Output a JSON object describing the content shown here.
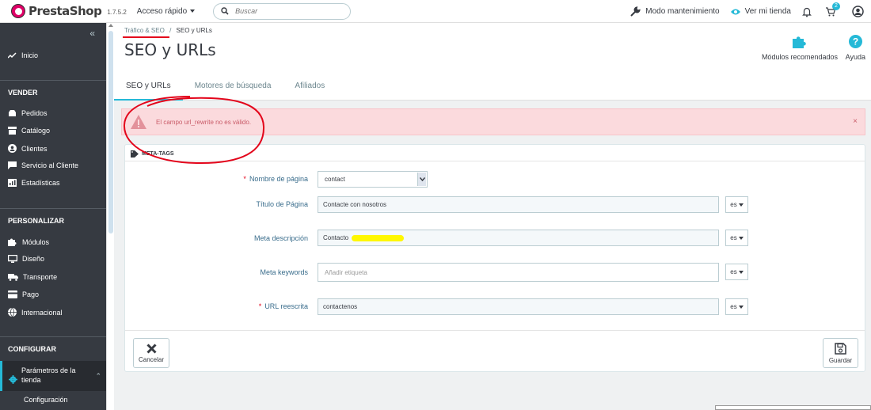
{
  "topbar": {
    "logo_text": "PrestaShop",
    "version": "1.7.5.2",
    "quick_access": "Acceso rápido",
    "search_placeholder": "Buscar",
    "maintenance": "Modo mantenimiento",
    "view_store": "Ver mi tienda",
    "notification_count": "2"
  },
  "sidebar": {
    "home": "Inicio",
    "sections": [
      {
        "title": "VENDER",
        "items": [
          "Pedidos",
          "Catálogo",
          "Clientes",
          "Servicio al Cliente",
          "Estadísticas"
        ]
      },
      {
        "title": "PERSONALIZAR",
        "items": [
          "Módulos",
          "Diseño",
          "Transporte",
          "Pago",
          "Internacional"
        ]
      },
      {
        "title": "CONFIGURAR",
        "items": [
          "Parámetros de la tienda"
        ]
      }
    ],
    "sub_item": "Configuración"
  },
  "header": {
    "breadcrumb": [
      "Tráfico & SEO",
      "SEO y URLs"
    ],
    "breadcrumb_sep": "/",
    "title": "SEO y URLs",
    "toolbar": {
      "modules": "Módulos recomendados",
      "help": "Ayuda"
    },
    "tabs": [
      "SEO y URLs",
      "Motores de búsqueda",
      "Afiliados"
    ]
  },
  "alert": {
    "message": "El campo url_rewrite no es válido.",
    "close": "×"
  },
  "panel": {
    "heading": "META-TAGS",
    "fields": {
      "page_name": {
        "label": "Nombre de página",
        "value": "contact"
      },
      "page_title": {
        "label": "Título de Página",
        "value": "Contacte con nosotros",
        "lang": "es"
      },
      "meta_description": {
        "label": "Meta descripción",
        "value": "Contacto",
        "lang": "es"
      },
      "meta_keywords": {
        "label": "Meta keywords",
        "placeholder": "Añadir etiqueta",
        "lang": "es"
      },
      "url_rewrite": {
        "label": "URL reescrita",
        "value": "contactenos",
        "lang": "es"
      }
    },
    "required_mark": "*",
    "cancel": "Cancelar",
    "save": "Guardar"
  },
  "colors": {
    "accent": "#25b9d7",
    "sidebar_bg": "#363a41",
    "alert_bg": "#fbdadd",
    "annotation": "#e3051b"
  }
}
